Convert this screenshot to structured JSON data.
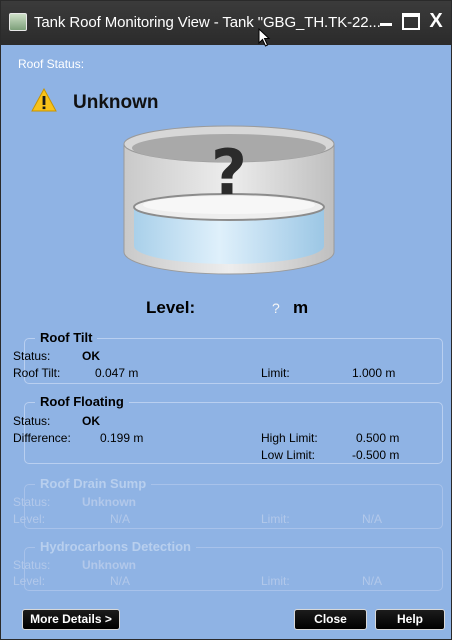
{
  "window": {
    "title": "Tank Roof Monitoring View - Tank \"GBG_TH.TK-22...",
    "close_glyph": "X"
  },
  "roof_status": {
    "label": "Roof Status:",
    "value": "Unknown",
    "icon": "warning-icon",
    "icon_color": "#f8c21a"
  },
  "tank_graphic": {
    "icon": "question-mark-icon",
    "mark": "?"
  },
  "level": {
    "label": "Level:",
    "value": "?",
    "unit": "m"
  },
  "roof_tilt": {
    "title": "Roof Tilt",
    "status_label": "Status:",
    "status_value": "OK",
    "tilt_label": "Roof Tilt:",
    "tilt_value": "0.047 m",
    "limit_label": "Limit:",
    "limit_value": "1.000 m"
  },
  "roof_floating": {
    "title": "Roof Floating",
    "status_label": "Status:",
    "status_value": "OK",
    "difference_label": "Difference:",
    "difference_value": "0.199 m",
    "high_limit_label": "High Limit:",
    "high_limit_value": "0.500 m",
    "low_limit_label": "Low Limit:",
    "low_limit_value": "-0.500 m"
  },
  "roof_drain_sump": {
    "title": "Roof Drain Sump",
    "status_label": "Status:",
    "status_value": "Unknown",
    "level_label": "Level:",
    "level_value": "N/A",
    "limit_label": "Limit:",
    "limit_value": "N/A"
  },
  "hydrocarbons_detection": {
    "title": "Hydrocarbons Detection",
    "status_label": "Status:",
    "status_value": "Unknown",
    "level_label": "Level:",
    "level_value": "N/A",
    "limit_label": "Limit:",
    "limit_value": "N/A"
  },
  "buttons": {
    "more_details": "More Details >",
    "close": "Close",
    "help": "Help"
  }
}
